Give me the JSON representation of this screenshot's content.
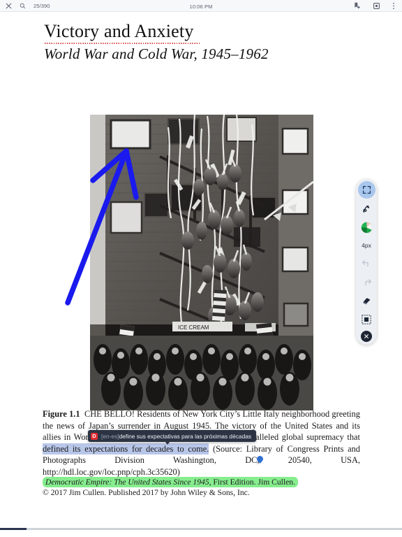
{
  "appbar": {
    "close_label": "×",
    "page_indicator": "25/390",
    "clock": "10:06 PM",
    "icons": {
      "close": "close-icon",
      "search": "search-icon",
      "bookmark_add": "bookmark-add-icon",
      "settings": "settings-icon",
      "overflow": "more-vertical-icon"
    }
  },
  "document": {
    "title": "Victory and Anxiety",
    "subtitle": "World War and Cold War, 1945–1962",
    "caption": {
      "label": "Figure 1.1",
      "part1": "CHE BELLO! Residents of New York City’s Little Italy neighborhood greeting the news of Japan’s surrender in August 1945. The victory of the United States and its allies in World War II left the nation in a position of unparalleled global supremacy that ",
      "selected": "defined its expectations for decades to come.",
      "part2": " (Source: Library of Congress Prints and Photographs Division Washington, DC, 20540, USA, http://hdl.loc.gov/loc.pnp/cph.3c35620)"
    },
    "credits": {
      "book_title": "Democratic Empire: The United States Since 1945,",
      "edition": " First Edition. Jim Cullen.",
      "copyright": "© 2017 Jim Cullen. Published 2017 by John Wiley & Sons, Inc."
    }
  },
  "tooltip": {
    "badge": "D",
    "lang": "[en-es]",
    "text": "define sus expectativas para las próximas décadas"
  },
  "drawbar": {
    "stroke_width": "4px",
    "selected_color": "#1faa4b",
    "tools": [
      {
        "name": "expand-icon",
        "state": "active"
      },
      {
        "name": "pen-icon",
        "state": "normal"
      },
      {
        "name": "color-wheel-icon",
        "state": "normal"
      },
      {
        "name": "stroke-width-label",
        "state": "normal"
      },
      {
        "name": "undo-icon",
        "state": "disabled"
      },
      {
        "name": "redo-icon",
        "state": "disabled"
      },
      {
        "name": "eraser-icon",
        "state": "normal"
      },
      {
        "name": "select-area-icon",
        "state": "normal"
      },
      {
        "name": "close-icon",
        "state": "normal"
      }
    ]
  },
  "progress": {
    "percent": 6.6
  }
}
